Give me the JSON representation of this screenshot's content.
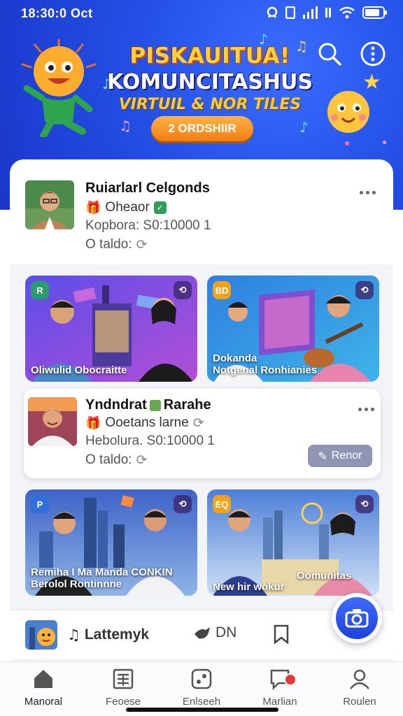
{
  "status_bar": {
    "time": "18:30:0 Oct"
  },
  "hero": {
    "title_line1": "PISKAUITUA!",
    "title_line2": "KOMUNCITASHUS",
    "title_line3": "VIRTUIL & NOR TILES",
    "cta_label": "2 ORDSHIIR"
  },
  "post_card_1": {
    "name": "Ruiarlarl Celgonds",
    "tag": "Oheaor",
    "subline": "Kopbora: S0:10000 1",
    "meta": "O taldo:"
  },
  "tiles_row_1": [
    {
      "caption": "Oliwulid Obocraitte",
      "badge": "R"
    },
    {
      "caption": "Dokanda\nNotgenal Ronhianies",
      "badge": "BD"
    }
  ],
  "post_card_2": {
    "name": "Yndndrat",
    "name_suffix": "Rarahe",
    "tag": "Ooetans larne",
    "subline": "Hebolura. S0:10000 1",
    "meta": "O taldo:",
    "follow_label": "Renor"
  },
  "tiles_row_2": [
    {
      "caption": "Remiha I Ma Manda CONKIN\nBerolol Rontinnne",
      "badge": "P"
    },
    {
      "caption": "New hir wokur",
      "caption_right": "Oomunitas",
      "badge": "EQ"
    }
  ],
  "mini_player": {
    "title": "Lattemyk",
    "control_label": "DN"
  },
  "bottom_nav": [
    {
      "label": "Manoral",
      "icon": "home-icon"
    },
    {
      "label": "Feoese",
      "icon": "newspaper-icon"
    },
    {
      "label": "Enlseeh",
      "icon": "square-dots-icon"
    },
    {
      "label": "Marlian",
      "icon": "chat-icon"
    },
    {
      "label": "Roulen",
      "icon": "profile-icon"
    }
  ],
  "colors": {
    "hero_blue": "#2450e6",
    "accent_orange": "#f07d12",
    "badge_red": "#e53935"
  }
}
